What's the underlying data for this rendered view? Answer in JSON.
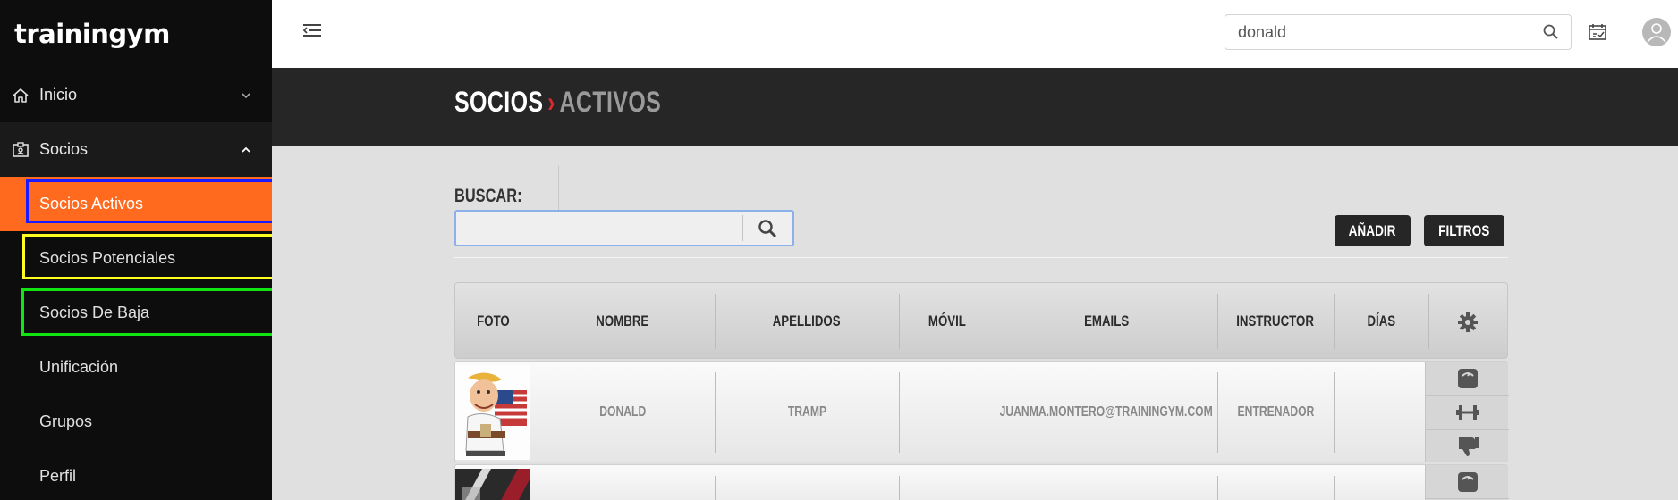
{
  "brand": {
    "logo_text": "trainingym"
  },
  "sidebar": {
    "items": [
      {
        "label": "Inicio",
        "icon": "home-icon"
      },
      {
        "label": "Socios",
        "icon": "id-card-icon"
      }
    ],
    "subitems": [
      {
        "label": "Socios Activos"
      },
      {
        "label": "Socios Potenciales"
      },
      {
        "label": "Socios De Baja"
      },
      {
        "label": "Unificación"
      },
      {
        "label": "Grupos"
      },
      {
        "label": "Perfil"
      }
    ]
  },
  "topbar": {
    "search_value": "donald"
  },
  "page_title": {
    "section": "SOCIOS",
    "separator": "›",
    "subsection": "ACTIVOS"
  },
  "search": {
    "label": "BUSCAR:",
    "value": ""
  },
  "buttons": {
    "add": "AÑADIR",
    "filters": "FILTROS"
  },
  "table": {
    "headers": [
      "FOTO",
      "NOMBRE",
      "APELLIDOS",
      "MÓVIL",
      "EMAILS",
      "INSTRUCTOR",
      "DÍAS"
    ],
    "rows": [
      {
        "nombre": "DONALD",
        "apellidos": "TRAMP",
        "movil": "",
        "email": "JUANMA.MONTERO@TRAININGYM.COM",
        "instructor": "ENTRENADOR",
        "dias": ""
      }
    ]
  },
  "colors": {
    "accent": "#ff6a1e",
    "sidebar_bg": "#0d0d0d",
    "title_band": "#262626",
    "separator_red": "#d9282f"
  }
}
